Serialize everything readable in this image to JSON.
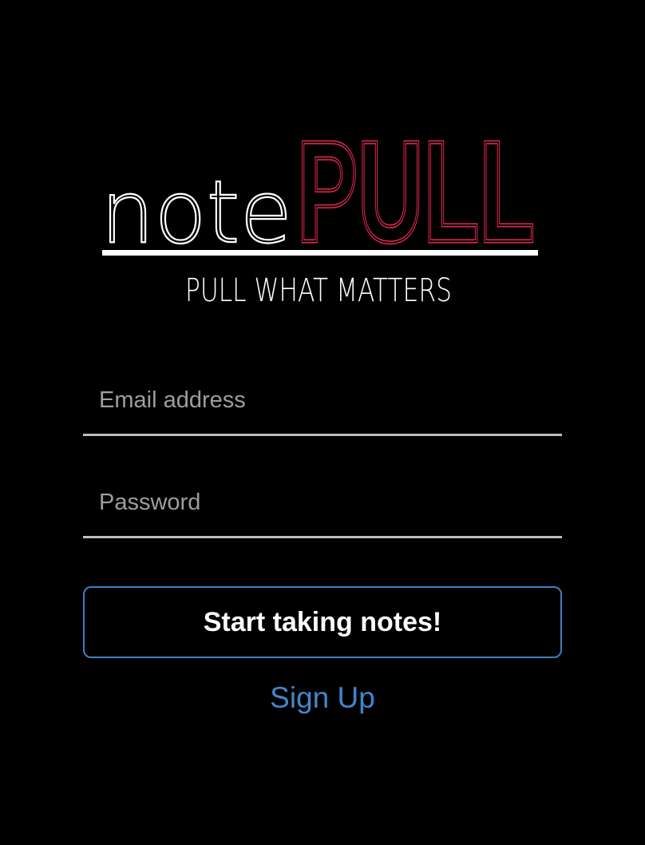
{
  "logo": {
    "brand_thin": "note",
    "brand_bold": "PULL",
    "tagline": "PULL WHAT MATTERS",
    "colors": {
      "thin_text": "#ffffff",
      "bold_text": "#e8284f",
      "underline": "#ffffff"
    }
  },
  "form": {
    "email_placeholder": "Email address",
    "email_value": "",
    "password_placeholder": "Password",
    "password_value": "",
    "submit_label": "Start taking notes!",
    "signup_label": "Sign Up"
  },
  "colors": {
    "background": "#000000",
    "accent_border": "#3f7fc1",
    "link": "#3f87cb",
    "field_underline": "#bdbdbd"
  }
}
